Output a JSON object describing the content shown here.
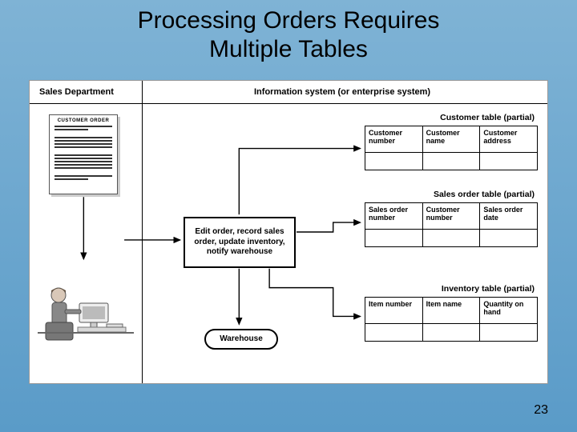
{
  "title_line1": "Processing Orders Requires",
  "title_line2": "Multiple Tables",
  "headers": {
    "sales": "Sales Department",
    "info": "Information system (or enterprise system)"
  },
  "order_doc_title": "CUSTOMER ORDER",
  "process_text": "Edit order, record sales order, update inventory, notify warehouse",
  "warehouse_label": "Warehouse",
  "tables": {
    "customer": {
      "label": "Customer table (partial)",
      "cols": [
        "Customer number",
        "Customer name",
        "Customer address"
      ]
    },
    "sales_order": {
      "label": "Sales order table (partial)",
      "cols": [
        "Sales order number",
        "Customer number",
        "Sales order date"
      ]
    },
    "inventory": {
      "label": "Inventory table (partial)",
      "cols": [
        "Item number",
        "Item name",
        "Quantity on hand"
      ]
    }
  },
  "page_number": "23"
}
